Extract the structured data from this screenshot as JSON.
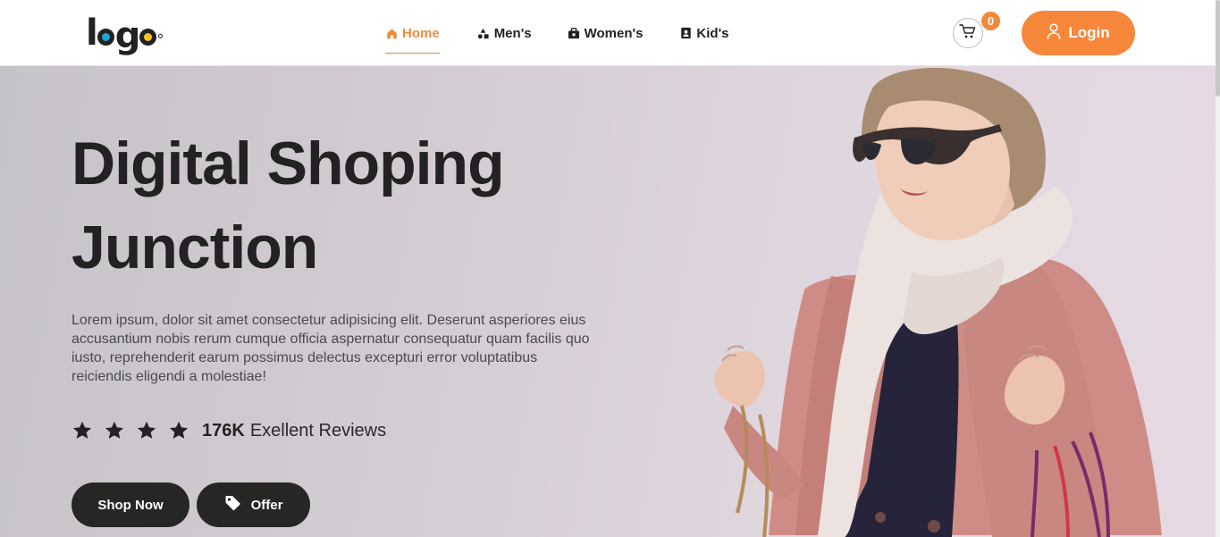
{
  "logo": {
    "text": "logo"
  },
  "nav": {
    "items": [
      {
        "label": "Home",
        "icon": "home-icon",
        "active": true
      },
      {
        "label": "Men's",
        "icon": "shapes-icon",
        "active": false
      },
      {
        "label": "Women's",
        "icon": "bag-icon",
        "active": false
      },
      {
        "label": "Kid's",
        "icon": "contact-icon",
        "active": false
      }
    ]
  },
  "cart": {
    "count": "0"
  },
  "login": {
    "label": "Login"
  },
  "hero": {
    "title_line1": "Digital Shoping",
    "title_line2": "Junction",
    "description": "Lorem ipsum, dolor sit amet consectetur adipisicing elit. Deserunt asperiores eius accusantium nobis rerum cumque officia aspernatur consequatur quam facilis quo iusto, reprehenderit earum possimus delectus excepturi error voluptatibus reiciendis eligendi a molestiae!",
    "rating": {
      "stars": 4,
      "count": "176K",
      "label": "Exellent Reviews"
    },
    "buttons": {
      "shop": "Shop Now",
      "offer": "Offer"
    }
  },
  "colors": {
    "accent": "#f7873a",
    "dark": "#262724",
    "text": "#222222"
  }
}
